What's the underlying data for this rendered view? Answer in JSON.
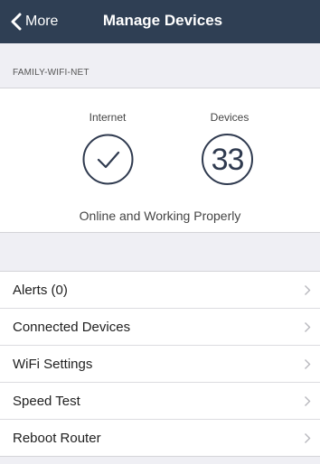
{
  "navbar": {
    "back_label": "More",
    "title": "Manage Devices"
  },
  "network": {
    "name": "FAMILY-WIFI-NET"
  },
  "status": {
    "internet_label": "Internet",
    "devices_label": "Devices",
    "device_count": "33",
    "status_text": "Online and Working Properly"
  },
  "menu": {
    "items": [
      {
        "label": "Alerts (0)"
      },
      {
        "label": "Connected Devices"
      },
      {
        "label": "WiFi Settings"
      },
      {
        "label": "Speed Test"
      },
      {
        "label": "Reboot Router"
      }
    ]
  },
  "icons": {
    "back": "chevron-left-icon",
    "internet": "checkmark-circle-icon",
    "row_chevron": "chevron-right-icon"
  },
  "colors": {
    "navbar_bg": "#2f3f54",
    "accent": "#2f3a4f",
    "background": "#efeff4"
  }
}
